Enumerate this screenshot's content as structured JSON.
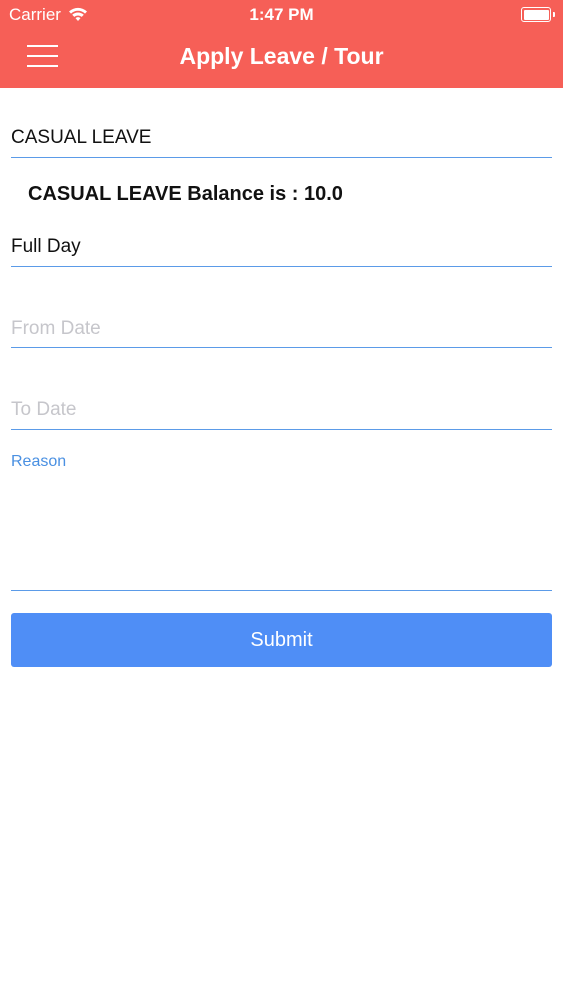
{
  "status_bar": {
    "carrier": "Carrier",
    "time": "1:47 PM"
  },
  "header": {
    "title": "Apply Leave / Tour",
    "background": "#f65f57"
  },
  "form": {
    "leave_type": "CASUAL LEAVE",
    "balance_text": "CASUAL LEAVE Balance is : 10.0",
    "day_type": "Full Day",
    "from_date_placeholder": "From Date",
    "to_date_placeholder": "To Date",
    "reason_label": "Reason",
    "submit_label": "Submit",
    "accent": "#4f8ef6",
    "underline": "#5b9be8"
  },
  "icons": {
    "menu": "hamburger-menu-icon",
    "wifi": "wifi-icon",
    "battery": "battery-icon"
  }
}
